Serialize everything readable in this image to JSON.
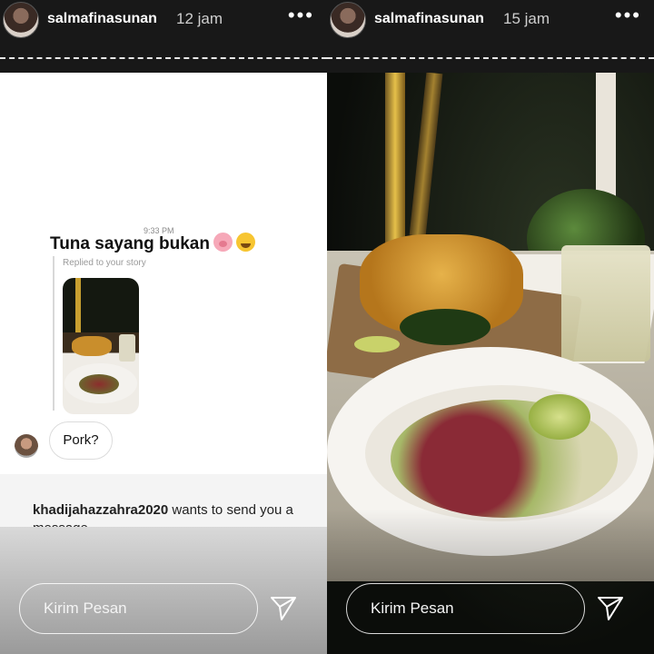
{
  "stories": [
    {
      "username": "salmafinasunan",
      "timestamp": "12 jam",
      "more_icon": "more-horizontal-icon",
      "dm": {
        "time": "9:33 PM",
        "title": "Tuna sayang bukan",
        "title_emojis": [
          "pig-emoji",
          "crying-emoji"
        ],
        "replied_label": "Replied to your story",
        "reply_text": "Pork?",
        "request_username": "khadijahazzahra2020",
        "request_text": " wants to send you a message"
      },
      "reply_placeholder": "Kirim Pesan",
      "send_icon": "send-icon"
    },
    {
      "username": "salmafinasunan",
      "timestamp": "15 jam",
      "more_icon": "more-horizontal-icon",
      "reply_placeholder": "Kirim Pesan",
      "send_icon": "send-icon"
    }
  ],
  "colors": {
    "header_bg": "#181818",
    "text_light": "#ffffff",
    "dm_bg": "#ffffff"
  }
}
